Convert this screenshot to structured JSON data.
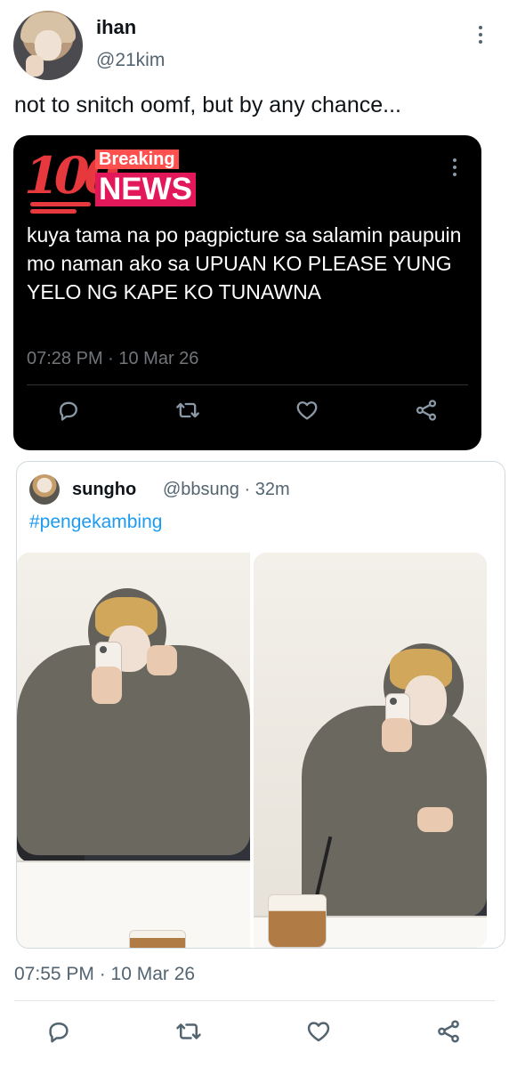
{
  "main_tweet": {
    "display_name": "ihan",
    "handle": "@21kim",
    "text": "not to snitch oomf, but by any chance...",
    "timestamp": "07:55 PM · 10 Mar 26"
  },
  "embedded_card": {
    "logo_text": "100",
    "breaking_label": "Breaking",
    "news_label": "NEWS",
    "body": "kuya tama na po pagpicture sa salamin paupuin mo naman ako sa UPUAN KO PLEASE YUNG YELO NG KAPE KO TUNAWNA",
    "timestamp": "07:28 PM · 10 Mar 26"
  },
  "quoted_tweet": {
    "display_name": "sungho",
    "handle_time": "@bbsung · 32m",
    "hashtag": "#pengekambing"
  },
  "icons": {
    "reply": "chat-bubble-icon",
    "retweet": "retweet-icon",
    "like": "heart-icon",
    "share": "share-icon",
    "more": "more-vertical-icon"
  },
  "colors": {
    "link": "#1d9bf0",
    "muted": "#536471",
    "card_background": "#000000",
    "breaking_red": "#ff5050",
    "news_pink": "#e2185b"
  }
}
